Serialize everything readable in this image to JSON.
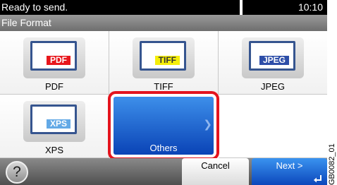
{
  "status_bar": {
    "message": "Ready to send.",
    "time": "10:10"
  },
  "title": "File Format",
  "options": [
    {
      "label": "PDF",
      "tag": "PDF",
      "tag_color": "#e8171c",
      "selected": false
    },
    {
      "label": "TIFF",
      "tag": "TIFF",
      "tag_color": "#f5ee0a",
      "selected": false
    },
    {
      "label": "JPEG",
      "tag": "JPEG",
      "tag_color": "#2d4ea8",
      "selected": false
    },
    {
      "label": "XPS",
      "tag": "XPS",
      "tag_color": "#63a9e6",
      "selected": false
    },
    {
      "label": "Others",
      "selected": true,
      "icon": "chevron-right-icon"
    }
  ],
  "bottom_bar": {
    "help_label": "?",
    "cancel_label": "Cancel",
    "next_label": "Next >"
  },
  "highlight_color": "#e4141e",
  "accent_color": "#0c47bb",
  "figure_code": "GB0082_01"
}
